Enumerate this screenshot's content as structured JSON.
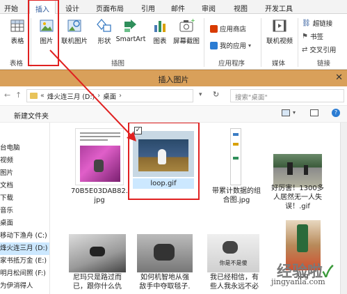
{
  "ribbon": {
    "tabs": [
      "开始",
      "插入",
      "设计",
      "页面布局",
      "引用",
      "邮件",
      "审阅",
      "视图",
      "开发工具"
    ],
    "buttons": {
      "table": "表格",
      "picture": "图片",
      "online_picture": "联机图片",
      "shapes": "形状",
      "smartart": "SmartArt",
      "chart": "图表",
      "screenshot": "屏幕截图",
      "app_store": "应用商店",
      "my_apps": "我的应用",
      "online_video": "联机视频",
      "hyperlink": "超链接",
      "bookmark": "书签",
      "cross_ref": "交叉引用"
    },
    "groups": {
      "tables": "表格",
      "illustrations": "插图",
      "apps": "应用程序",
      "media": "媒体",
      "links": "链接"
    }
  },
  "dialog": {
    "title": "插入图片",
    "close": "✕",
    "breadcrumb": [
      "«",
      "烽火连三月 (D:)",
      "›",
      "桌面",
      "›"
    ],
    "search_placeholder": "搜索\"桌面\"",
    "new_folder": "新建文件夹",
    "nav_items": [
      "台电脑",
      "视频",
      "图片",
      "文档",
      "下载",
      "音乐",
      "桌面",
      "移动下渔舟 (C:)",
      "烽火连三月 (D:)",
      "家书抵万金 (E:)",
      "明月松间照 (F:)",
      "为伊消得人"
    ],
    "files": [
      {
        "name": "70B5E03DAB82.\njpg"
      },
      {
        "name": "loop.gif"
      },
      {
        "name": "带累计数据的组\n合图.jpg"
      },
      {
        "name": "好厉害！1300多\n人居然无一人失\n误！.gif"
      },
      {
        "name": "尼玛只是路过而\n已，跟你什么仇"
      },
      {
        "name": "如何机智地从强\n敌手中夺取毯子."
      },
      {
        "name": "我已经相信，有\n些人我永远不必"
      },
      {
        "name": "jpg"
      }
    ],
    "thumb_caption": "你是不是傻",
    "checkbox_mark": "✓"
  },
  "watermark": {
    "text": "经验啦",
    "domain": "jingyanla.com",
    "check": "✓"
  }
}
